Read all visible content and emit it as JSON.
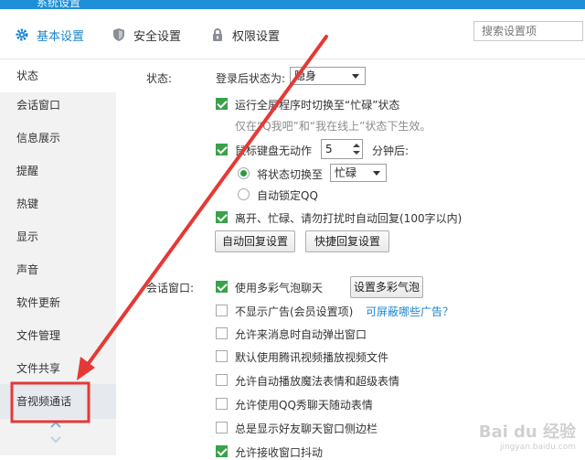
{
  "window": {
    "title": "系统设置"
  },
  "tabs": [
    {
      "label": "基本设置",
      "icon": "gear-icon",
      "active": true
    },
    {
      "label": "安全设置",
      "icon": "shield-icon",
      "active": false
    },
    {
      "label": "权限设置",
      "icon": "lock-icon",
      "active": false
    }
  ],
  "search": {
    "placeholder": "搜索设置项"
  },
  "sidebar": {
    "items": [
      {
        "label": "状态"
      },
      {
        "label": "会话窗口"
      },
      {
        "label": "信息展示"
      },
      {
        "label": "提醒"
      },
      {
        "label": "热键"
      },
      {
        "label": "显示"
      },
      {
        "label": "声音"
      },
      {
        "label": "软件更新"
      },
      {
        "label": "文件管理"
      },
      {
        "label": "文件共享"
      },
      {
        "label": "音视频通话"
      }
    ]
  },
  "status_section": {
    "heading": "状态:",
    "login_label": "登录后状态为:",
    "login_value": "隐身",
    "fullscreen_label": "运行全屏程序时切换至“忙碌”状态",
    "fullscreen_checked": true,
    "fullscreen_hint": "仅在“Q我吧”和“我在线上”状态下生效。",
    "idle_label": "鼠标键盘无动作",
    "idle_checked": true,
    "idle_minutes": "5",
    "idle_suffix": "分钟后:",
    "switch_label": "将状态切换至",
    "switch_value": "忙碌",
    "switch_selected": true,
    "lock_label": "自动锁定QQ",
    "autoreply_label": "离开、忙碌、请勿打扰时自动回复(100字以内)",
    "autoreply_checked": true,
    "autoreply_btn": "自动回复设置",
    "quickreply_btn": "快捷回复设置"
  },
  "session_section": {
    "heading": "会话窗口:",
    "bubble_label": "使用多彩气泡聊天",
    "bubble_checked": true,
    "bubble_btn": "设置多彩气泡",
    "noad_label": "不显示广告(会员设置项)",
    "noad_link": "可屏蔽哪些广告？",
    "popup_label": "允许来消息时自动弹出窗口",
    "video_label": "默认使用腾讯视频播放视频文件",
    "magic_label": "允许自动播放魔法表情和超级表情",
    "qqshow_label": "允许使用QQ秀聊天随动表情",
    "sidebar_label": "总是显示好友聊天窗口侧边栏",
    "shake_label": "允许接收窗口抖动"
  },
  "colors": {
    "accent": "#1a86d0",
    "check": "#3aa14a",
    "annotation": "#e53935"
  },
  "watermark": {
    "brand": "Bai du 经验",
    "url": "jingyan.baidu.com"
  }
}
